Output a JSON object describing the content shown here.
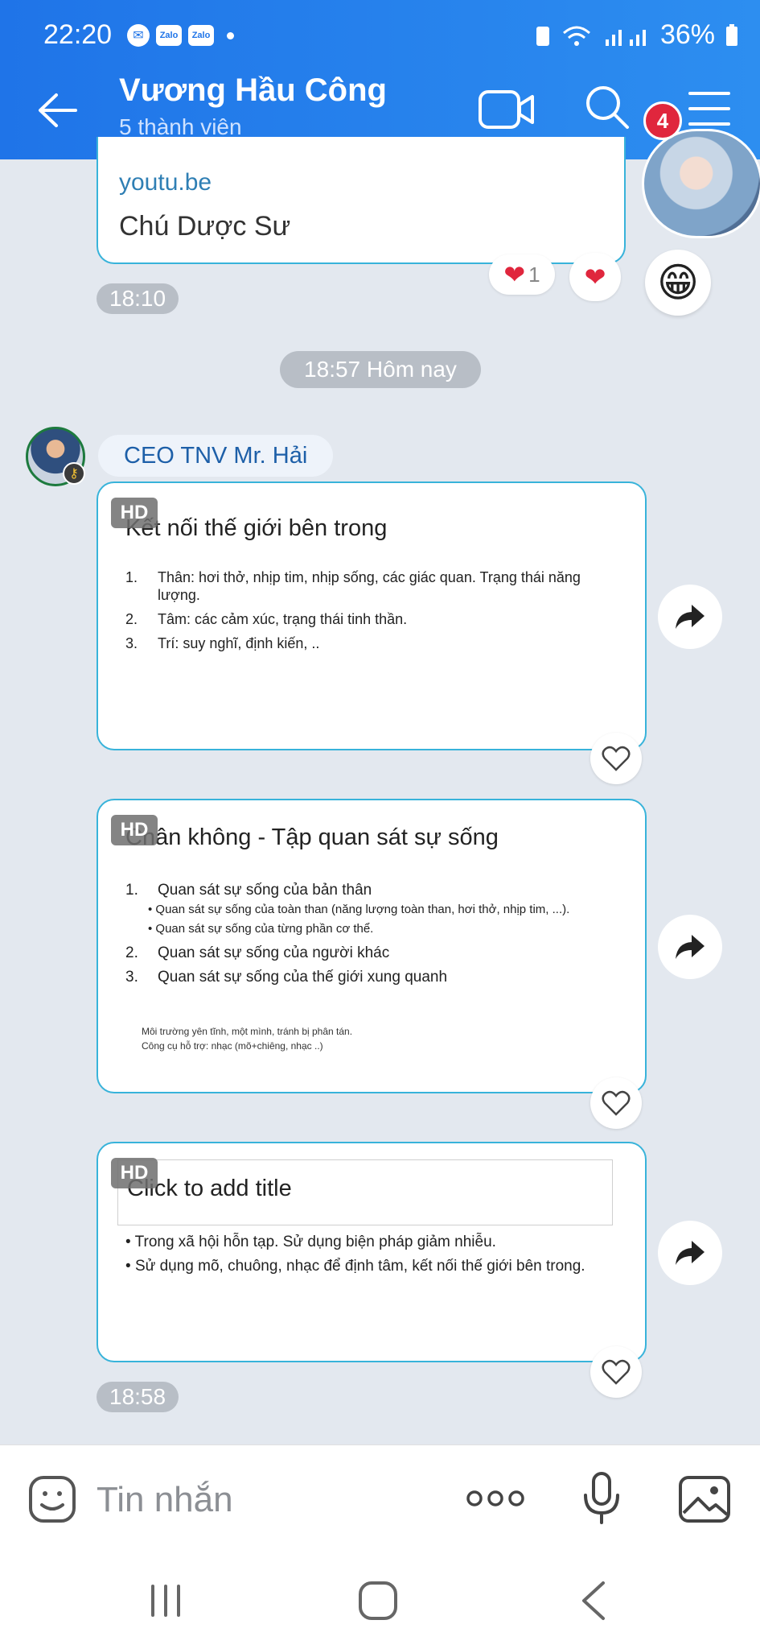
{
  "status_bar": {
    "time": "22:20",
    "app_icons": [
      "messenger-icon",
      "Zalo",
      "Zalo"
    ],
    "battery": "36%"
  },
  "header": {
    "title": "Vương Hầu Công",
    "subtitle": "5 thành viên",
    "floating_badge_count": "4"
  },
  "link_message": {
    "domain": "youtu.be",
    "title": "Chú Dược Sư",
    "reaction_count": "1",
    "time": "18:10"
  },
  "date_divider": "18:57 Hôm nay",
  "sender": {
    "name": "CEO TNV Mr. Hải"
  },
  "slides": [
    {
      "hd": "HD",
      "title": "Kết nối thế giới bên trong",
      "items": [
        {
          "num": "1.",
          "text": "Thân: hơi thở, nhịp tim, nhịp sống, các giác quan. Trạng thái năng lượng."
        },
        {
          "num": "2.",
          "text": "Tâm: các cảm xúc, trạng thái tinh thần."
        },
        {
          "num": "3.",
          "text": "Trí: suy nghĩ, định kiến, .."
        }
      ]
    },
    {
      "hd": "HD",
      "title": "Chân không - Tập quan sát sự sống",
      "items": [
        {
          "num": "1.",
          "text": "Quan sát sự sống của bản thân"
        },
        {
          "num": "2.",
          "text": "Quan sát sự sống của người khác"
        },
        {
          "num": "3.",
          "text": "Quan sát sự sống của thế giới xung quanh"
        }
      ],
      "sub_items": [
        "Quan sát sự sống của toàn than (năng lượng toàn than, hơi thở, nhịp tim, ...).",
        "Quan sát sự sống của từng phần cơ thể."
      ],
      "notes": [
        "Môi trường yên tĩnh, một mình, tránh bị phân tán.",
        "Công cụ hỗ trợ: nhạc (mõ+chiêng, nhạc ..)"
      ]
    },
    {
      "hd": "HD",
      "title": "Click to add title",
      "bullets": [
        "Trong xã hội hỗn tạp. Sử dụng biện pháp giảm nhiễu.",
        "Sử dụng mõ, chuông, nhạc để định tâm, kết nối thế giới bên trong."
      ]
    }
  ],
  "last_time": "18:58",
  "composer": {
    "placeholder": "Tin nhắn"
  }
}
